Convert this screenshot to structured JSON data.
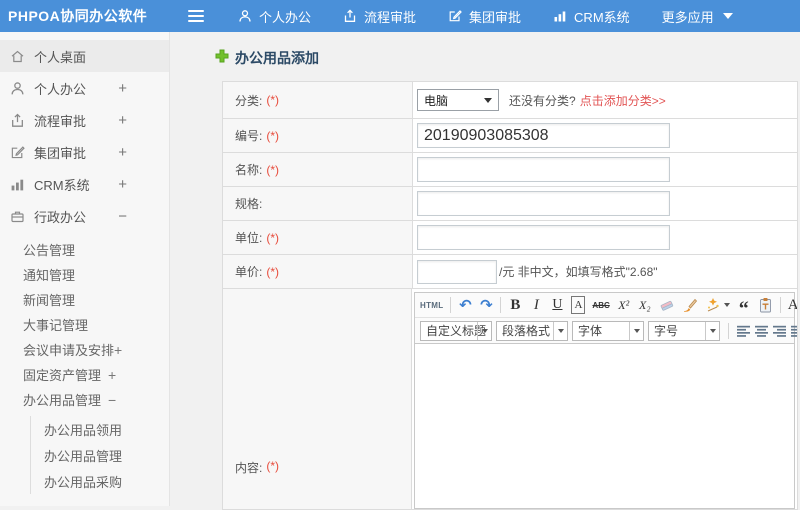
{
  "topbar": {
    "brand": "PHPOA协同办公软件",
    "nav": [
      {
        "label": "个人办公",
        "icon": "user-icon"
      },
      {
        "label": "流程审批",
        "icon": "share-icon"
      },
      {
        "label": "集团审批",
        "icon": "edit-icon"
      },
      {
        "label": "CRM系统",
        "icon": "chart-icon"
      },
      {
        "label": "更多应用",
        "icon": "caret-down-icon"
      }
    ]
  },
  "sidebar": {
    "items": [
      {
        "label": "个人桌面",
        "icon": "home-icon",
        "expander": ""
      },
      {
        "label": "个人办公",
        "icon": "user-icon",
        "expander": "+"
      },
      {
        "label": "流程审批",
        "icon": "share-icon",
        "expander": "+"
      },
      {
        "label": "集团审批",
        "icon": "edit-icon",
        "expander": "+"
      },
      {
        "label": "CRM系统",
        "icon": "chart-icon",
        "expander": "+"
      },
      {
        "label": "行政办公",
        "icon": "briefcase-icon",
        "expander": "−"
      }
    ],
    "subitems": [
      {
        "label": "公告管理",
        "expander": ""
      },
      {
        "label": "通知管理",
        "expander": ""
      },
      {
        "label": "新闻管理",
        "expander": ""
      },
      {
        "label": "大事记管理",
        "expander": ""
      },
      {
        "label": "会议申请及安排",
        "expander": "+"
      },
      {
        "label": "固定资产管理",
        "expander": "+"
      },
      {
        "label": "办公用品管理",
        "expander": "−"
      }
    ],
    "subsubitems": [
      {
        "label": "办公用品领用"
      },
      {
        "label": "办公用品管理"
      },
      {
        "label": "办公用品采购"
      }
    ]
  },
  "main": {
    "title": "办公用品添加",
    "form": {
      "category": {
        "label": "分类:",
        "required": "(*)",
        "selected": "电脑",
        "note": "还没有分类?",
        "link": "点击添加分类>>"
      },
      "code": {
        "label": "编号:",
        "required": "(*)",
        "value": "20190903085308"
      },
      "name": {
        "label": "名称:",
        "required": "(*)"
      },
      "spec": {
        "label": "规格:",
        "required": ""
      },
      "unit": {
        "label": "单位:",
        "required": "(*)"
      },
      "price": {
        "label": "单价:",
        "required": "(*)",
        "suffix": "/元 非中文，如填写格式\"2.68\""
      },
      "content": {
        "label": "内容:",
        "required": "(*)"
      }
    }
  },
  "editor": {
    "html_btn": "HTML",
    "undo_glyph": "↶",
    "redo_glyph": "↷",
    "bold": "B",
    "italic": "I",
    "underline": "U",
    "box_a": "A",
    "strike": "ABC",
    "superscript": "X²",
    "subscript": "X₂",
    "quote_glyph": "“",
    "font_color": "A",
    "highlight": "ab",
    "selects": [
      {
        "value": "自定义标题"
      },
      {
        "value": "段落格式"
      },
      {
        "value": "字体"
      },
      {
        "value": "字号"
      }
    ]
  },
  "colors": {
    "topbar_blue": "#4a90d9",
    "title_navy": "#2c4a66",
    "required_red": "#e74c3c",
    "link_red": "#e25555",
    "plus_green": "#72c02c"
  }
}
